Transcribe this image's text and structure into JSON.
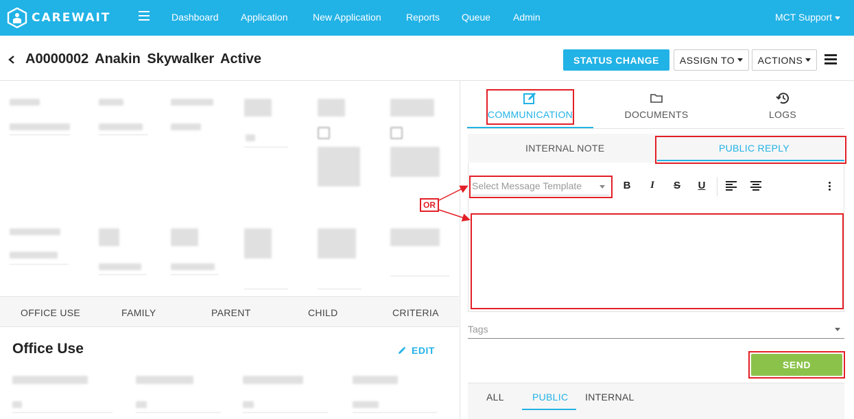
{
  "brand": {
    "name": "CAREWAIT",
    "accent": "#21b2e6",
    "send_color": "#8bc34a",
    "annotation_color": "#e21f26"
  },
  "nav": {
    "items": [
      "Dashboard",
      "Application",
      "New Application",
      "Reports",
      "Queue",
      "Admin"
    ],
    "user": "MCT Support"
  },
  "header": {
    "title": "A0000002 Anakin Skywalker Active",
    "status_change": "STATUS CHANGE",
    "assign_to": "ASSIGN TO",
    "actions": "ACTIONS"
  },
  "left": {
    "tabs": [
      "OFFICE USE",
      "FAMILY",
      "PARENT",
      "CHILD",
      "CRITERIA"
    ],
    "section_title": "Office Use",
    "edit_label": "EDIT"
  },
  "right": {
    "tabs": [
      {
        "label": "COMMUNICATION",
        "icon": "edit-note-icon"
      },
      {
        "label": "DOCUMENTS",
        "icon": "folder-icon"
      },
      {
        "label": "LOGS",
        "icon": "history-icon"
      }
    ],
    "reply_tabs": [
      "INTERNAL NOTE",
      "PUBLIC REPLY"
    ],
    "template_placeholder": "Select Message Template",
    "toolbar": {
      "bold": "B",
      "italic": "I",
      "strike": "S",
      "underline": "U"
    },
    "tags_placeholder": "Tags",
    "send_label": "SEND",
    "filter_tabs": [
      "ALL",
      "PUBLIC",
      "INTERNAL"
    ]
  },
  "annotation": {
    "or_label": "OR"
  }
}
